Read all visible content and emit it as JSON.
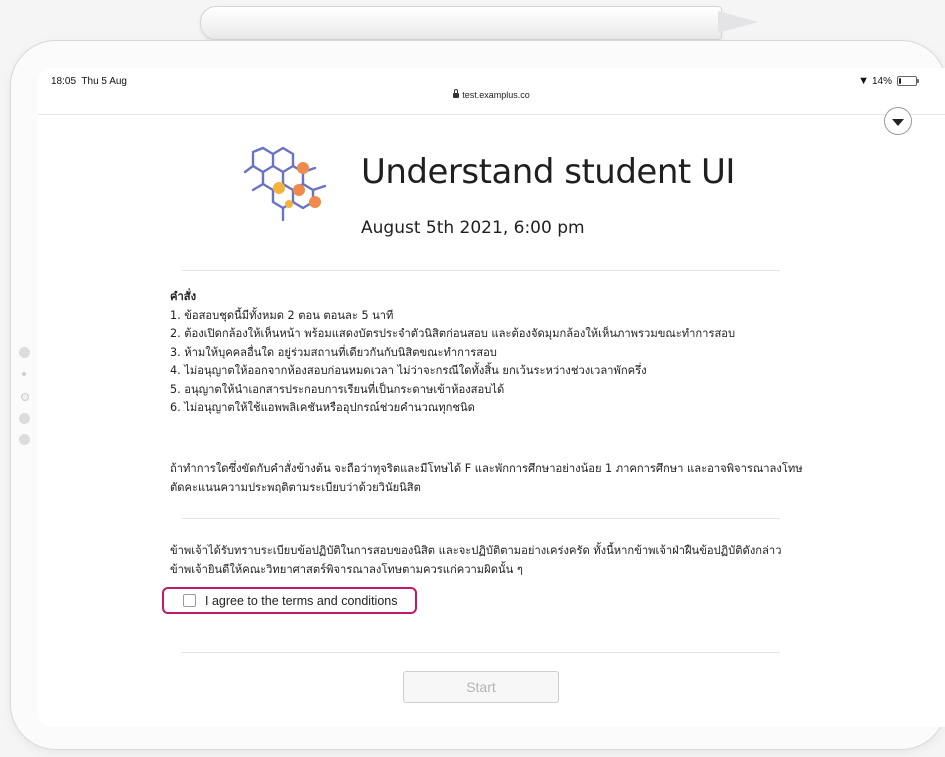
{
  "status_bar": {
    "time": "18:05  Thu 5 Aug",
    "url": "test.examplus.co",
    "battery": "14%",
    "battery_level": 0.14
  },
  "exam": {
    "title": "Understand student UI",
    "datetime": "August 5th 2021, 6:00 pm"
  },
  "instructions": {
    "heading": "คำสั่ง",
    "items": [
      "1. ข้อสอบชุดนี้มีทั้งหมด 2 ตอน ตอนละ 5 นาที",
      "2. ต้องเปิดกล้องให้เห็นหน้า พร้อมแสดงบัตรประจำตัวนิสิตก่อนสอบ และต้องจัดมุมกล้องให้เห็นภาพรวมขณะทำการสอบ",
      "3. ห้ามให้บุคคลอื่นใด อยู่ร่วมสถานที่เดียวกันกับนิสิตขณะทำการสอบ",
      "4. ไม่อนุญาตให้ออกจากห้องสอบก่อนหมดเวลา ไม่ว่าจะกรณีใดทั้งสิ้น ยกเว้นระหว่างช่วงเวลาพักครึ่ง",
      "5. อนุญาตให้นำเอกสารประกอบการเรียนที่เป็นกระดาษเข้าห้องสอบได้",
      "6. ไม่อนุญาตให้ใช้แอพพลิเคชันหรืออุปกรณ์ช่วยคำนวณทุกชนิด"
    ],
    "penalty": "ถ้าทำการใดซึ่งขัดกับคำสั่งข้างต้น จะถือว่าทุจริตและมีโทษได้ F และพักการศึกษาอย่างน้อย 1 ภาคการศึกษา และอาจพิจารณาลงโทษตัดคะแนนความประพฤติตามระเบียบว่าด้วยวินัยนิสิต"
  },
  "declaration": "ข้าพเจ้าได้รับทราบระเบียบข้อปฏิบัติในการสอบของนิสิต และจะปฏิบัติตามอย่างเคร่งครัด ทั้งนี้หากข้าพเจ้าฝ่าฝืนข้อปฏิบัติดังกล่าว ข้าพเจ้ายินดีให้คณะวิทยาศาสตร์พิจารณาลงโทษตามควรแก่ความผิดนั้น ๆ",
  "agree_label": "I agree to the terms and conditions",
  "start_label": "Start",
  "colors": {
    "highlight": "#c2186b",
    "logo_blue": "#6a72c4",
    "logo_orange": "#f08a4b",
    "logo_yellow": "#f4b43c"
  }
}
